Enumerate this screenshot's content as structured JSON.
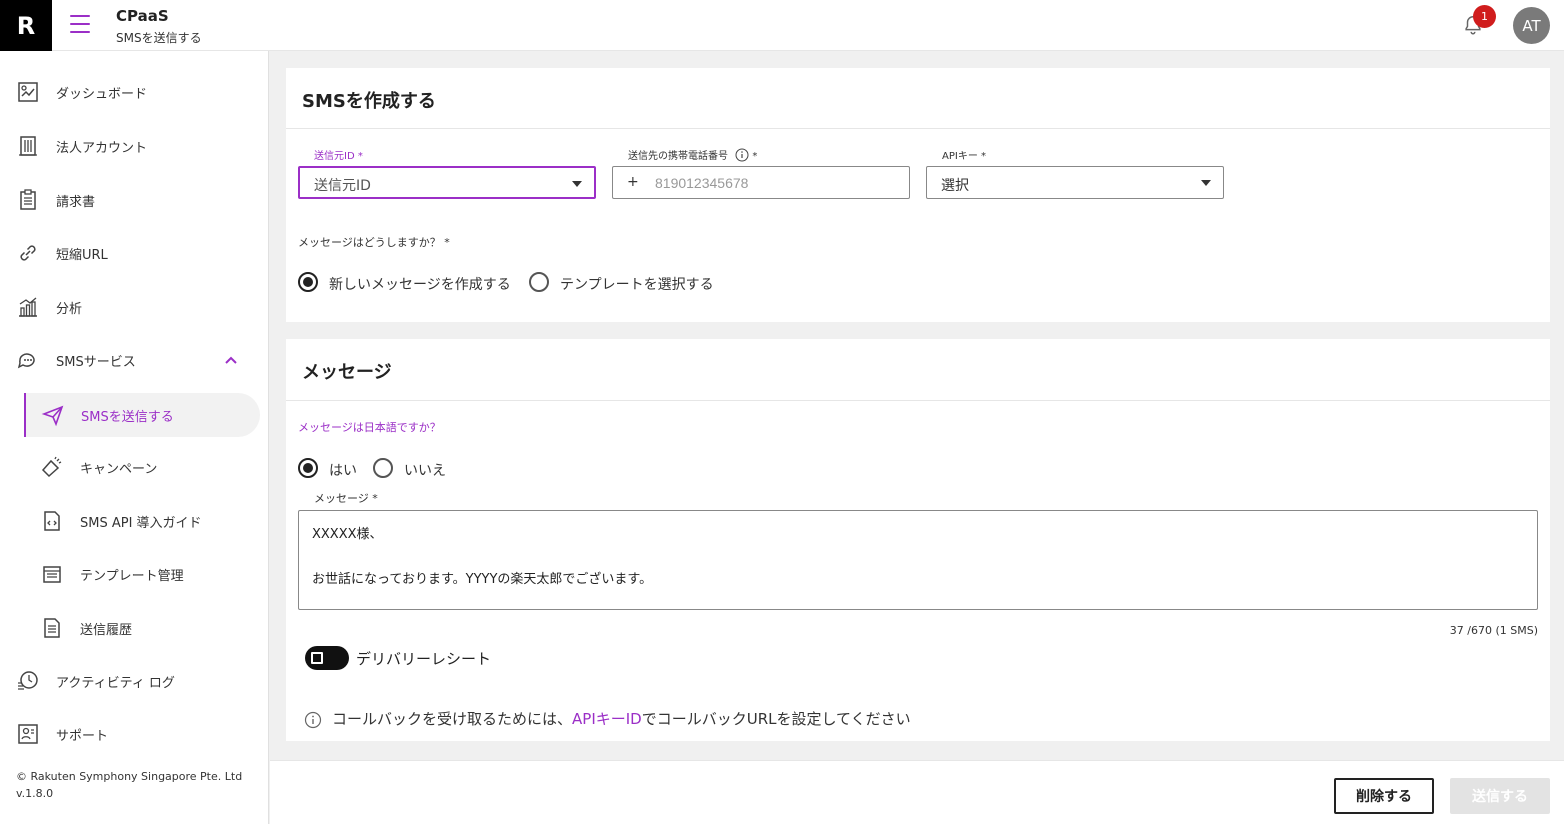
{
  "header": {
    "logo": "R",
    "app_title": "CPaaS",
    "app_subtitle": "SMSを送信する",
    "notification_count": "1",
    "avatar_initials": "AT"
  },
  "sidebar": {
    "items": [
      {
        "label": "ダッシュボード",
        "icon": "dashboard-icon"
      },
      {
        "label": "法人アカウント",
        "icon": "building-icon"
      },
      {
        "label": "請求書",
        "icon": "invoice-icon"
      },
      {
        "label": "短縮URL",
        "icon": "link-icon"
      },
      {
        "label": "分析",
        "icon": "analytics-icon"
      },
      {
        "label": "SMSサービス",
        "icon": "chat-icon"
      },
      {
        "label": "SMSを送信する",
        "icon": "send-icon"
      },
      {
        "label": "キャンペーン",
        "icon": "megaphone-icon"
      },
      {
        "label": "SMS API 導入ガイド",
        "icon": "code-doc-icon"
      },
      {
        "label": "テンプレート管理",
        "icon": "template-icon"
      },
      {
        "label": "送信履歴",
        "icon": "history-doc-icon"
      },
      {
        "label": "アクティビティ ログ",
        "icon": "activity-log-icon"
      },
      {
        "label": "サポート",
        "icon": "support-icon"
      }
    ],
    "copyright": "© Rakuten Symphony Singapore Pte. Ltd",
    "version": "v.1.8.0"
  },
  "compose": {
    "title": "SMSを作成する",
    "sender_label": "送信元ID *",
    "sender_value": "送信元ID",
    "phone_label": "送信先の携帯電話番号",
    "phone_required": "*",
    "phone_prefix": "+",
    "phone_placeholder": "819012345678",
    "api_label": "APIキー *",
    "api_value": "選択",
    "message_mode_label": "メッセージはどうしますか？ *",
    "option_new": "新しいメッセージを作成する",
    "option_template": "テンプレートを選択する"
  },
  "message": {
    "title": "メッセージ",
    "japanese_question": "メッセージは日本語ですか？",
    "yes": "はい",
    "no": "いいえ",
    "message_label": "メッセージ *",
    "line1": "XXXXX様、",
    "line2": "お世話になっております。YYYYの楽天太郎でございます。",
    "counter": "37 /670 (1 SMS)",
    "delivery_receipt": "デリバリーレシート",
    "callback_prefix": "コールバックを受け取るためには、",
    "callback_link": "APIキーID",
    "callback_suffix": "でコールバックURLを設定してください"
  },
  "actions": {
    "delete": "削除する",
    "send": "送信する"
  },
  "colors": {
    "accent": "#9b2fc7",
    "badge": "#d01d1d"
  }
}
